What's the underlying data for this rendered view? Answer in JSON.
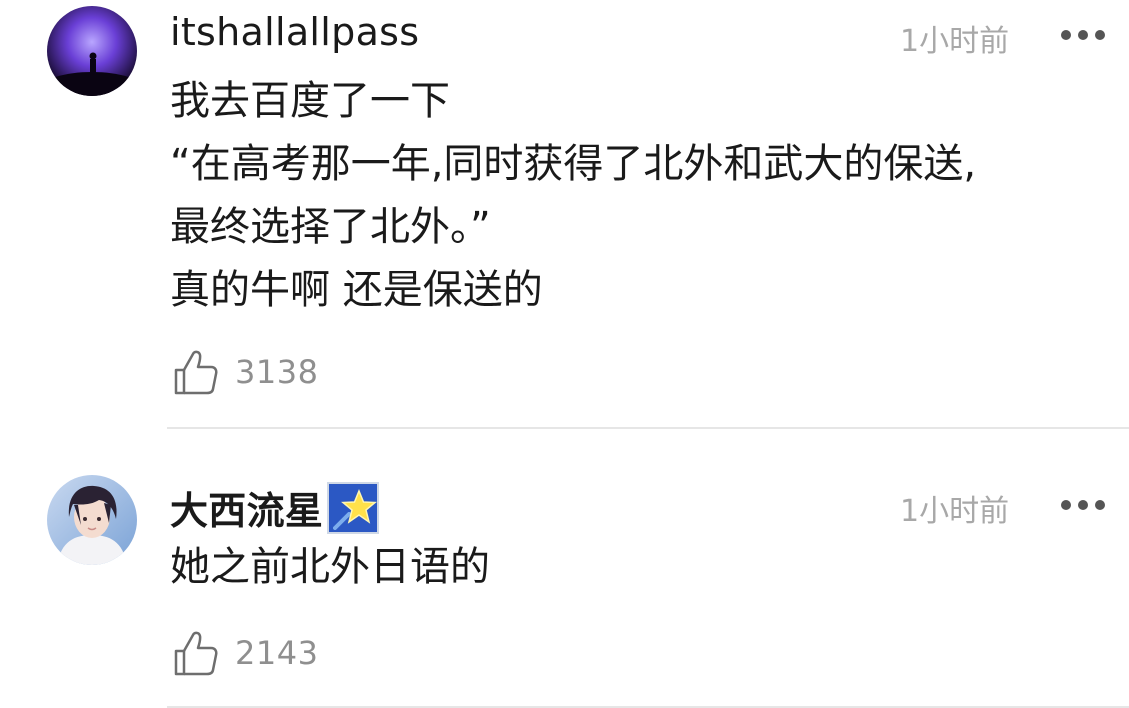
{
  "comments": [
    {
      "username": "itshallallpass",
      "time": "1小时前",
      "lines": [
        "我去百度了一下",
        "“在高考那一年,同时获得了北外和武大的保送,",
        "最终选择了北外。”",
        "真的牛啊 还是保送的"
      ],
      "likes": "3138",
      "avatar": "concert-silhouette"
    },
    {
      "username": "大西流星",
      "time": "1小时前",
      "lines": [
        "她之前北外日语的"
      ],
      "likes": "2143",
      "avatar": "person-portrait",
      "badge": "star-badge-icon"
    }
  ],
  "icons": {
    "like": "thumbs-up-icon",
    "more": "more-dots-icon"
  },
  "colors": {
    "text": "#1a1a1a",
    "meta": "#a8a8a8",
    "like_count": "#8f8f8f",
    "divider": "#e6e6e6"
  }
}
